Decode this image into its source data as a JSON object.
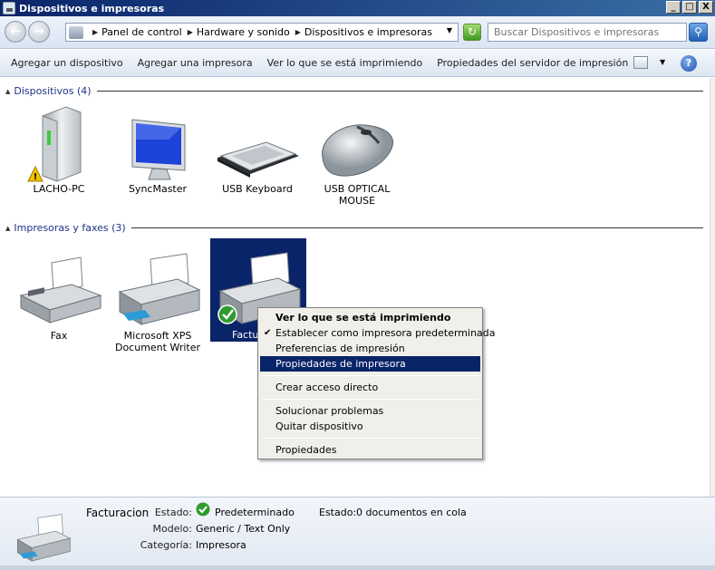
{
  "window": {
    "title": "Dispositivos e impresoras",
    "min": "_",
    "max": "□",
    "close": "X"
  },
  "address": {
    "segments": [
      "Panel de control",
      "Hardware y sonido",
      "Dispositivos e impresoras"
    ],
    "search_placeholder": "Buscar Dispositivos e impresoras"
  },
  "commands": {
    "items": [
      "Agregar un dispositivo",
      "Agregar una impresora",
      "Ver lo que se está imprimiendo",
      "Propiedades del servidor de impresión"
    ],
    "more": "»",
    "help": "?"
  },
  "groups": {
    "devices": {
      "header": "Dispositivos (4)",
      "items": [
        {
          "label": "LACHO-PC",
          "icon": "computer-tower-icon"
        },
        {
          "label": "SyncMaster",
          "icon": "monitor-icon"
        },
        {
          "label": "USB Keyboard",
          "icon": "keyboard-icon"
        },
        {
          "label": "USB OPTICAL MOUSE",
          "icon": "mouse-icon"
        }
      ]
    },
    "printers": {
      "header": "Impresoras y faxes (3)",
      "items": [
        {
          "label": "Fax",
          "icon": "fax-icon"
        },
        {
          "label": "Microsoft XPS Document Writer",
          "icon": "printer-icon"
        },
        {
          "label": "Factu",
          "icon": "printer-icon"
        }
      ]
    }
  },
  "context_menu": {
    "items": [
      "Ver lo que se está imprimiendo",
      "Establecer como impresora predeterminada",
      "Preferencias de impresión",
      "Propiedades de impresora",
      "Crear acceso directo",
      "Solucionar problemas",
      "Quitar dispositivo",
      "Propiedades"
    ]
  },
  "details": {
    "name": "Facturacion",
    "estado_label": "Estado:",
    "estado_value": "Predeterminado",
    "estado2_label": "Estado:",
    "estado2_value": "0 documentos en cola",
    "modelo_label": "Modelo:",
    "modelo_value": "Generic / Text Only",
    "categoria_label": "Categoría:",
    "categoria_value": "Impresora"
  },
  "colors": {
    "selection": "#0a246a",
    "titlebar": "#0a246a",
    "default_check": "#2e9b2e"
  }
}
